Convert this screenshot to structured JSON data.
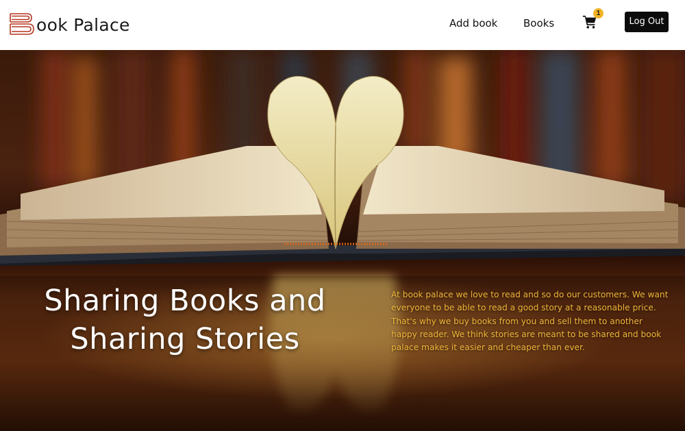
{
  "brand": {
    "name": "ook Palace",
    "logo_icon": "book-stack-b-icon",
    "logo_color": "#b5341c"
  },
  "nav": {
    "add_book_label": "Add book",
    "books_label": "Books",
    "cart_icon": "shopping-cart-icon",
    "cart_count": "1",
    "cart_badge_color": "#f0b323",
    "logout_label": "Log Out"
  },
  "hero": {
    "image_icon": "open-book-heart-photo",
    "title_line1": "Sharing Books and",
    "title_line2": "Sharing Stories",
    "description": "At book palace we love to read and so do our customers. We want everyone to be able to read a good story at a reasonable price. That's why we buy books from you and sell them to another happy reader. We think stories are meant to be shared and book palace makes it easier and cheaper than ever.",
    "text_color": "#f1b63a"
  }
}
